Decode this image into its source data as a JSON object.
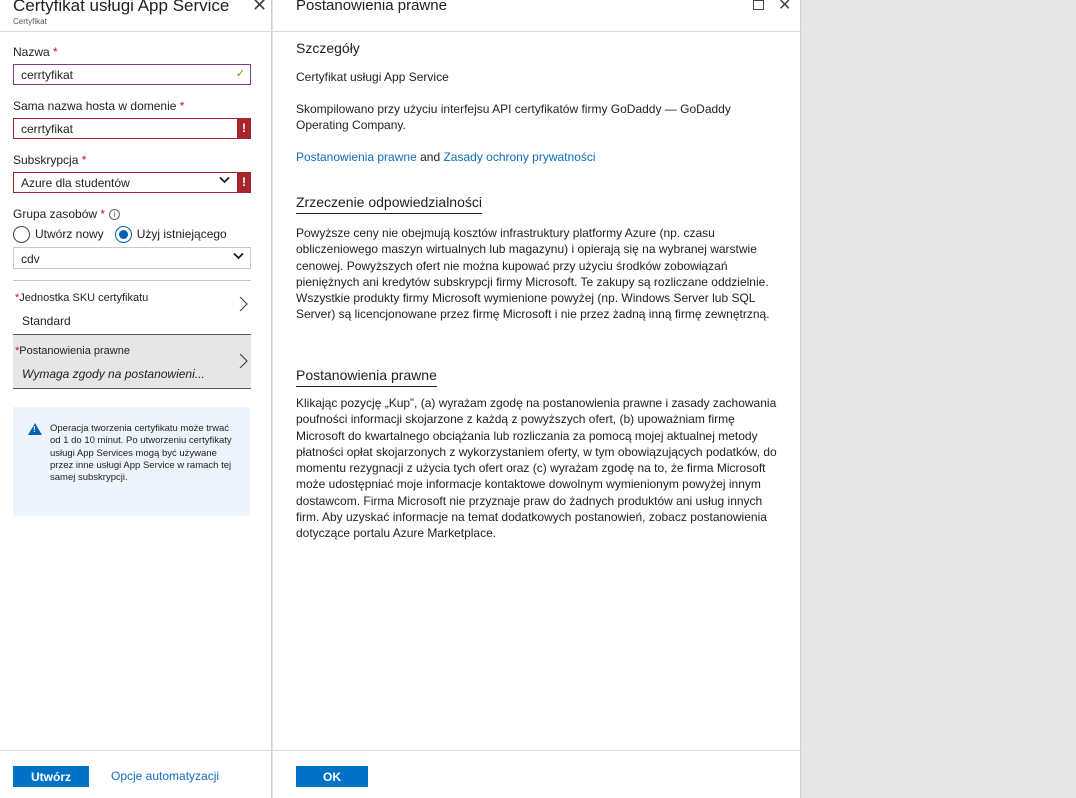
{
  "left_blade": {
    "title": "Certyfikat usługi App Service",
    "subtitle": "Certyfikat",
    "fields": {
      "name": {
        "label": "Nazwa",
        "required": "*",
        "value": "cerrtyfikat"
      },
      "hostname": {
        "label": "Sama nazwa hosta w domenie",
        "required": "*",
        "value": "cerrtyfikat"
      },
      "subscription": {
        "label": "Subskrypcja",
        "required": "*",
        "value": "Azure dla studentów"
      },
      "resource_group": {
        "label": "Grupa zasobów",
        "required": "*",
        "option_new": "Utwórz nowy",
        "option_existing": "Użyj istniejącego",
        "value": "cdv"
      }
    },
    "sku": {
      "label": "Jednostka SKU certyfikatu",
      "required": "*",
      "value": "Standard"
    },
    "legal": {
      "label": "Postanowienia prawne",
      "required": "*",
      "value": "Wymaga zgody na postanowieni..."
    },
    "notice": "Operacja tworzenia certyfikatu może trwać od 1 do 10 minut. Po utworzeniu certyfikaty usługi App Services mogą być używane przez inne usługi App Service w ramach tej samej subskrypcji.",
    "footer": {
      "create": "Utwórz",
      "automation": "Opcje automatyzacji"
    }
  },
  "right_blade": {
    "title": "Postanowienia prawne",
    "details_heading": "Szczegóły",
    "product": "Certyfikat usługi App Service",
    "compiled": "Skompilowano przy użyciu interfejsu API certyfikatów firmy GoDaddy — GoDaddy Operating Company.",
    "link_legal": "Postanowienia prawne",
    "and_word": "and",
    "link_privacy": "Zasady ochrony prywatności",
    "disclaimer_heading": "Zrzeczenie odpowiedzialności",
    "disclaimer_text": "Powyższe ceny nie obejmują kosztów infrastruktury platformy Azure (np. czasu obliczeniowego maszyn wirtualnych lub magazynu) i opierają się na wybranej warstwie cenowej. Powyższych ofert nie można kupować przy użyciu środków zobowiązań pieniężnych ani kredytów subskrypcji firmy Microsoft. Te zakupy są rozliczane oddzielnie. Wszystkie produkty firmy Microsoft wymienione powyżej (np. Windows Server lub SQL Server) są licencjonowane przez firmę Microsoft i nie przez żadną inną firmę zewnętrzną.",
    "legal_heading": "Postanowienia prawne",
    "legal_text": "Klikając pozycję „Kup”, (a) wyrażam zgodę na postanowienia prawne i zasady zachowania poufności informacji skojarzone z każdą z powyższych ofert, (b) upoważniam firmę Microsoft do kwartalnego obciążania lub rozliczania za pomocą mojej aktualnej metody płatności opłat skojarzonych z wykorzystaniem oferty, w tym obowiązujących podatków, do momentu rezygnacji z użycia tych ofert oraz (c) wyrażam zgodę na to, że firma Microsoft może udostępniać moje informacje kontaktowe dowolnym wymienionym powyżej innym dostawcom. Firma Microsoft nie przyznaje praw do żadnych produktów ani usług innych firm. Aby uzyskać informacje na temat dodatkowych postanowień, zobacz postanowienia dotyczące portalu Azure Marketplace.",
    "ok": "OK"
  },
  "colors": {
    "accent": "#0072c6",
    "link": "#0f6cbd",
    "error": "#a4262c",
    "valid": "#57a300"
  },
  "icons": [
    "close-icon",
    "checkmark-icon",
    "error-icon",
    "chevron-down-icon",
    "info-icon",
    "chevron-right-icon",
    "warning-icon",
    "maximize-icon"
  ]
}
